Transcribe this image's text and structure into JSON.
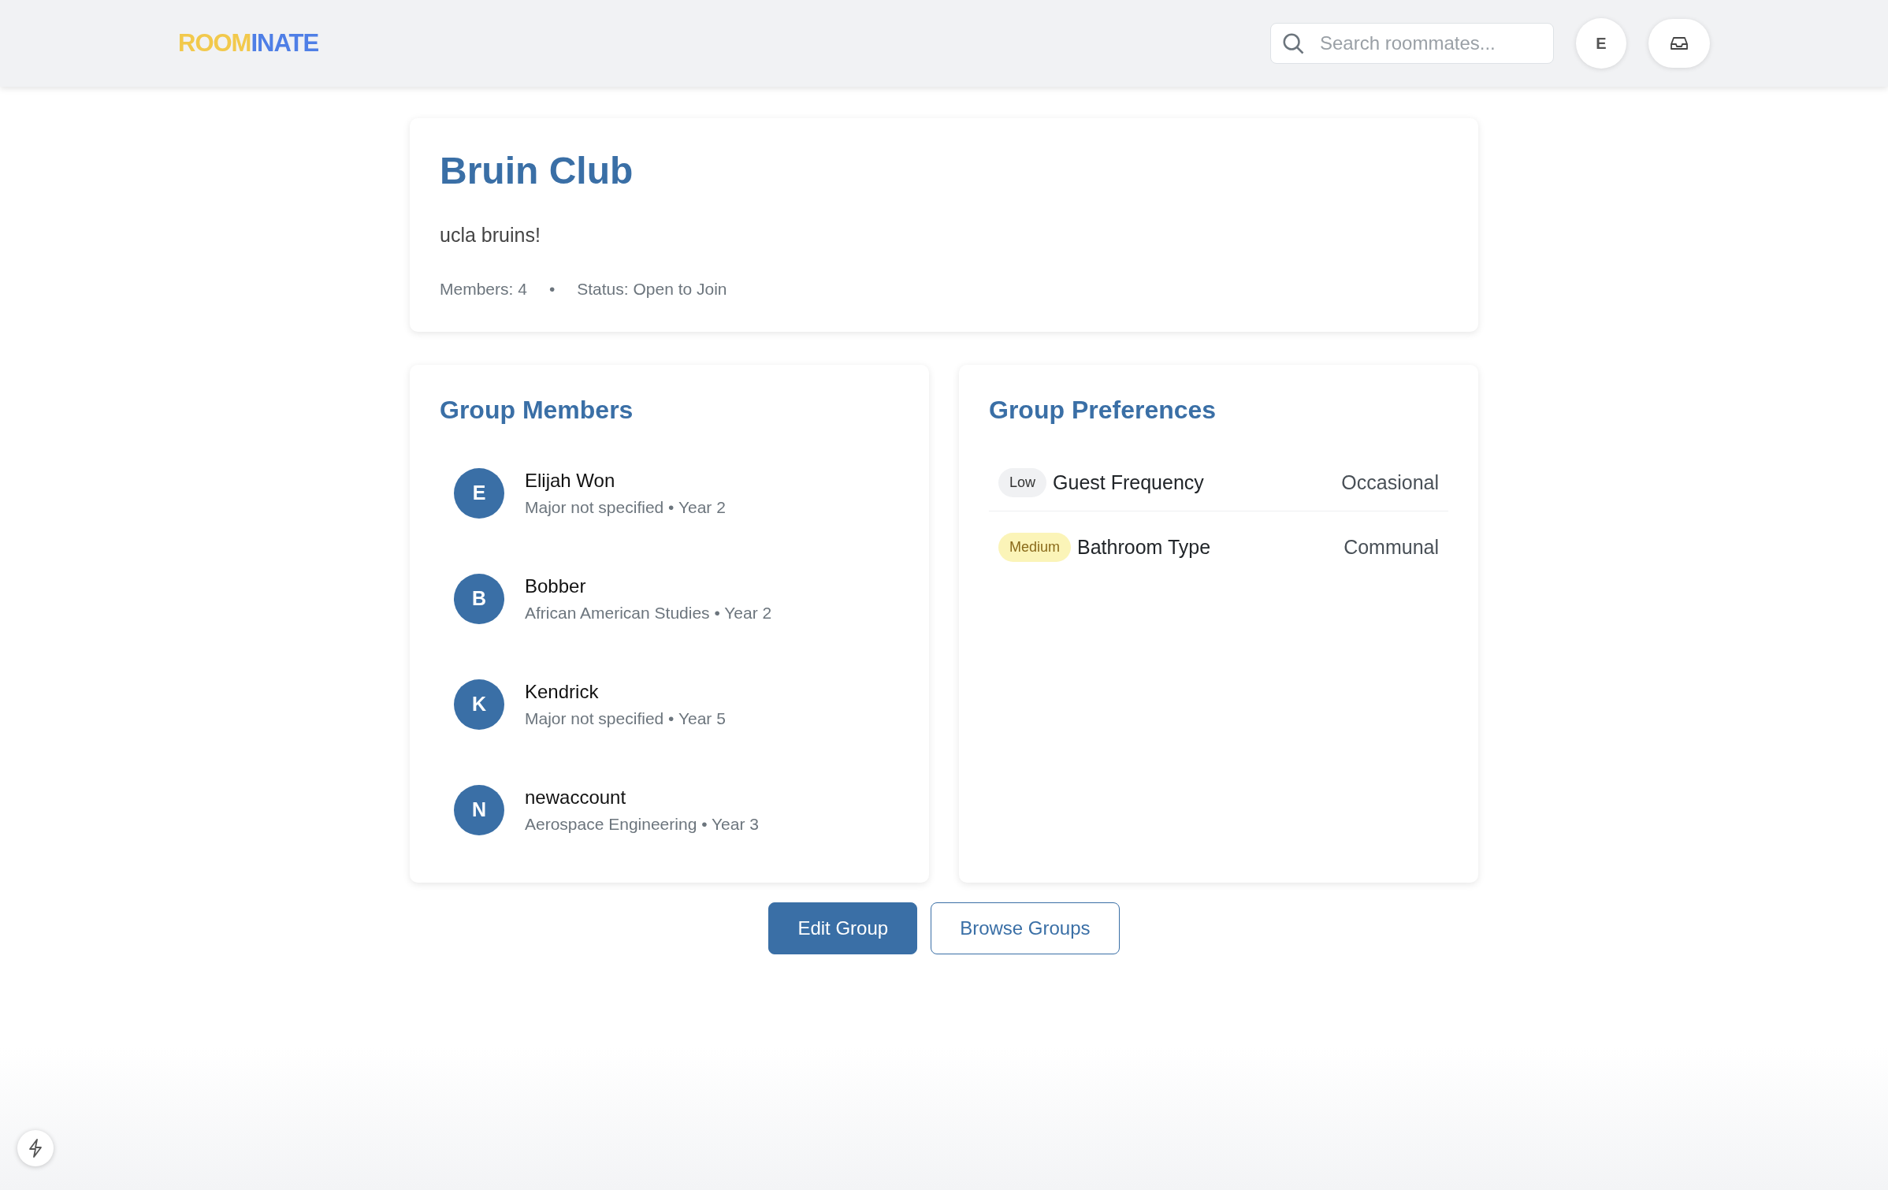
{
  "header": {
    "logo": [
      {
        "text": "ROOM",
        "color": "#f2c94c"
      },
      {
        "text": "INATE",
        "color": "#4f7fe6"
      }
    ],
    "search": {
      "placeholder": "Search roommates..."
    },
    "avatar": "E"
  },
  "group": {
    "title": "Bruin Club",
    "description": "ucla bruins!",
    "members_count": "Members: 4",
    "separator": "•",
    "status": "Status: Open to Join"
  },
  "members": {
    "title": "Group Members",
    "items": [
      {
        "initial": "E",
        "name": "Elijah Won",
        "detail": "Major not specified • Year 2"
      },
      {
        "initial": "B",
        "name": "Bobber",
        "detail": "African American Studies • Year 2"
      },
      {
        "initial": "K",
        "name": "Kendrick",
        "detail": "Major not specified • Year 5"
      },
      {
        "initial": "N",
        "name": "newaccount",
        "detail": "Aerospace Engineering • Year 3"
      }
    ]
  },
  "preferences": {
    "title": "Group Preferences",
    "items": [
      {
        "kind": "low",
        "priority": "Low",
        "label": "Guest Frequency",
        "value": "Occasional"
      },
      {
        "kind": "medium",
        "priority": "Medium",
        "label": "Bathroom Type",
        "value": "Communal"
      }
    ]
  },
  "buttons": [
    {
      "kind": "primary",
      "label": "Edit Group"
    },
    {
      "kind": "outline",
      "label": "Browse Groups"
    }
  ]
}
